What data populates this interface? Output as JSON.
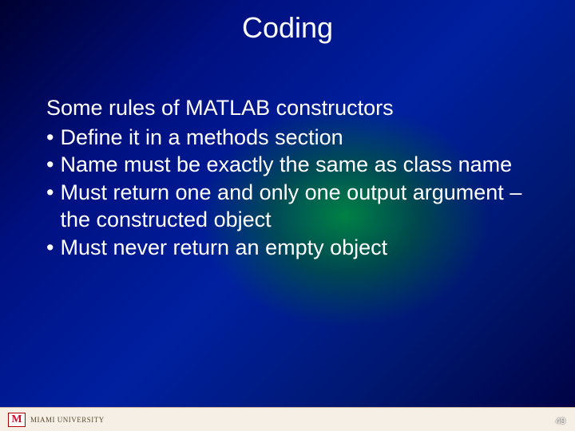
{
  "title": "Coding",
  "lead": "Some rules of MATLAB constructors",
  "bullets": [
    "Define it in a methods section",
    "Name must be exactly the same as class name",
    "Must return one and only one output argument – the constructed object",
    "Must never return an empty object"
  ],
  "footer": {
    "logo_mark": "M",
    "logo_text": "MIAMI UNIVERSITY"
  },
  "page_number": "49"
}
